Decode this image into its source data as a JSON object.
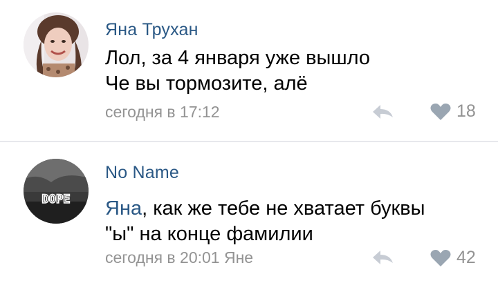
{
  "comments": [
    {
      "author": "Яна Трухан",
      "lines": [
        "Лол, за 4 января уже вышло",
        "Че вы тормозите, алё"
      ],
      "timestamp": "сегодня в 17:12",
      "likes": "18",
      "avatar_icon": "avatar-photo-girl"
    },
    {
      "author": "No Name",
      "mention": "Яна",
      "text_after_mention": ", как же тебе не хватает буквы",
      "line2": "\"ы\" на конце фамилии",
      "timestamp": "сегодня в 20:01 Яне",
      "likes": "42",
      "avatar_text": "DOPE"
    }
  ],
  "colors": {
    "author_link": "#2a5885",
    "meta_gray": "#939393",
    "icon_gray": "#9aa6b2",
    "divider": "#e7e8ec"
  },
  "icons": {
    "reply": "reply-arrow-icon",
    "like": "heart-icon"
  }
}
